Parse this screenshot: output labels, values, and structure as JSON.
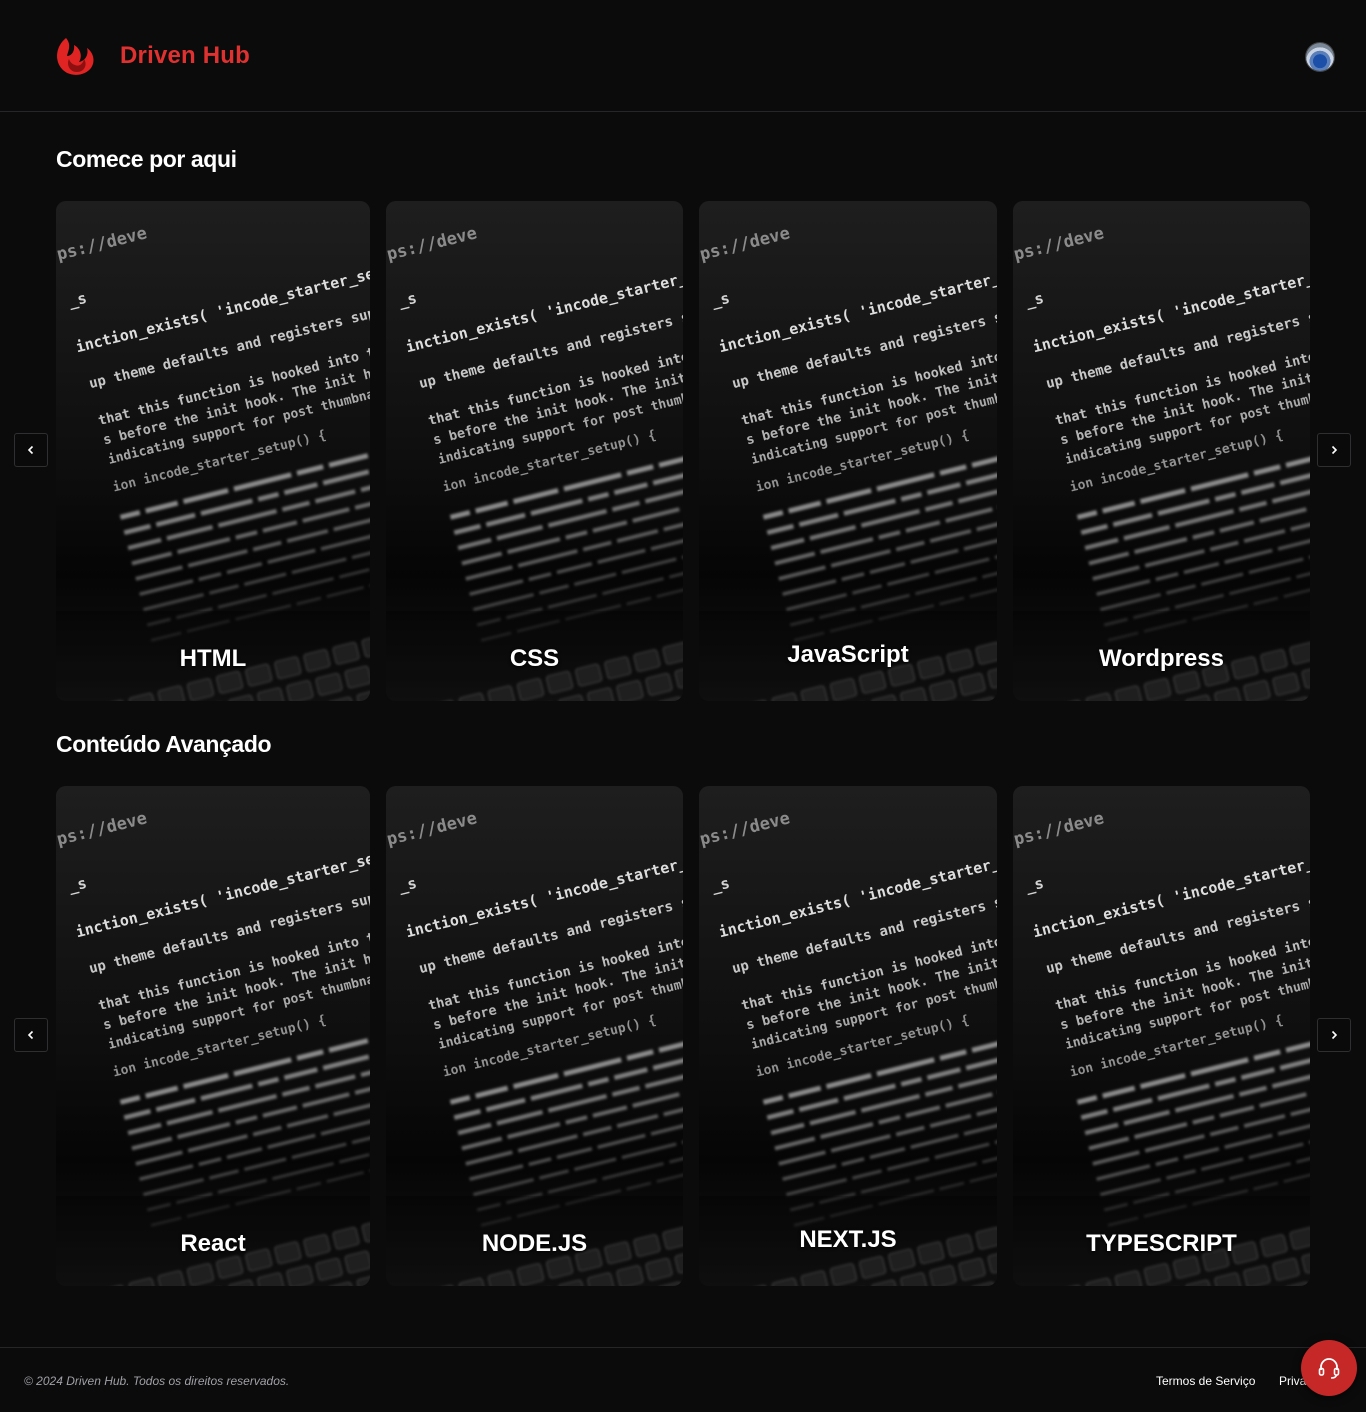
{
  "header": {
    "brand": "Driven Hub",
    "brand_color": "#e03131",
    "logo_icon": "flame-logo-icon",
    "avatar_icon": "user-avatar"
  },
  "sections": [
    {
      "title": "Comece por aqui",
      "cards": [
        {
          "label": "HTML"
        },
        {
          "label": "CSS"
        },
        {
          "label": "JavaScript"
        },
        {
          "label": "Wordpress"
        }
      ]
    },
    {
      "title": "Conteúdo Avançado",
      "cards": [
        {
          "label": "React"
        },
        {
          "label": "NODE.JS"
        },
        {
          "label": "NEXT.JS"
        },
        {
          "label": "TYPESCRIPT"
        }
      ]
    }
  ],
  "card_image_text": {
    "url": "ps://deve",
    "line1": "_s",
    "line2": "inction_exists( 'incode_starter_setup'",
    "line3": "up theme defaults and registers suppor",
    "line4": "that this function is hooked into the",
    "line5": "s before the init hook. The init hook is",
    "line6": "indicating support for post thumbnails.",
    "line7": "ion incode_starter_setup() {"
  },
  "footer": {
    "copyright": "© 2024 Driven Hub. Todos os direitos reservados.",
    "terms": "Termos de Serviço",
    "privacy": "Privacidade"
  },
  "support_icon": "headset-icon",
  "accent_color": "#c62828"
}
